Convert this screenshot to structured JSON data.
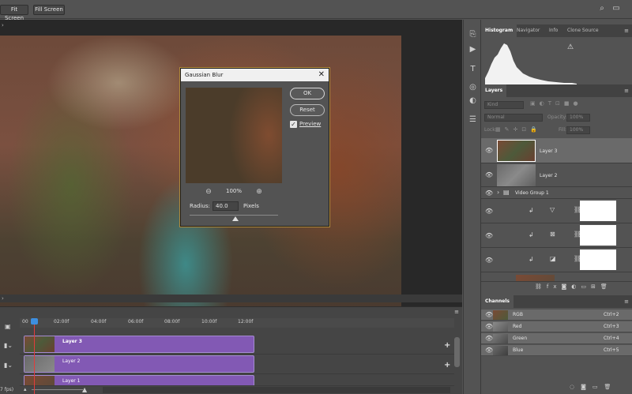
{
  "optionsbar": {
    "fit_screen": "Fit Screen",
    "fill_screen": "Fill Screen"
  },
  "dialog": {
    "title": "Gaussian Blur",
    "ok": "OK",
    "reset": "Reset",
    "preview_label": "Preview",
    "preview_checked": true,
    "zoom": "100%",
    "radius_label": "Radius:",
    "radius_value": "40.0",
    "radius_unit": "Pixels"
  },
  "histogram_panel": {
    "tabs": [
      "Histogram",
      "Navigator",
      "Info",
      "Clone Source"
    ],
    "active_tab": "Histogram"
  },
  "layers_panel": {
    "tab": "Layers",
    "kind_label": "Kind",
    "blend_mode": "Normal",
    "opacity_label": "Opacity:",
    "opacity_value": "100%",
    "lock_label": "Lock:",
    "fill_label": "Fill:",
    "fill_value": "100%",
    "layers": [
      {
        "name": "Layer 3"
      },
      {
        "name": "Layer 2"
      },
      {
        "name": "Video Group 1"
      }
    ]
  },
  "channels_panel": {
    "tab": "Channels",
    "channels": [
      {
        "name": "RGB",
        "shortcut": "Ctrl+2"
      },
      {
        "name": "Red",
        "shortcut": "Ctrl+3"
      },
      {
        "name": "Green",
        "shortcut": "Ctrl+4"
      },
      {
        "name": "Blue",
        "shortcut": "Ctrl+5"
      }
    ]
  },
  "timeline": {
    "ticks": [
      "00",
      "02:00f",
      "04:00f",
      "06:00f",
      "08:00f",
      "10:00f",
      "12:00f"
    ],
    "tracks": [
      {
        "name": "Layer 3"
      },
      {
        "name": "Layer 2"
      },
      {
        "name": "Layer 1"
      }
    ],
    "fps": "7 fps)"
  },
  "colors": {
    "clip": "#8259b4",
    "playhead": "#e23c3c",
    "dialog_border": "#b08a3a"
  }
}
